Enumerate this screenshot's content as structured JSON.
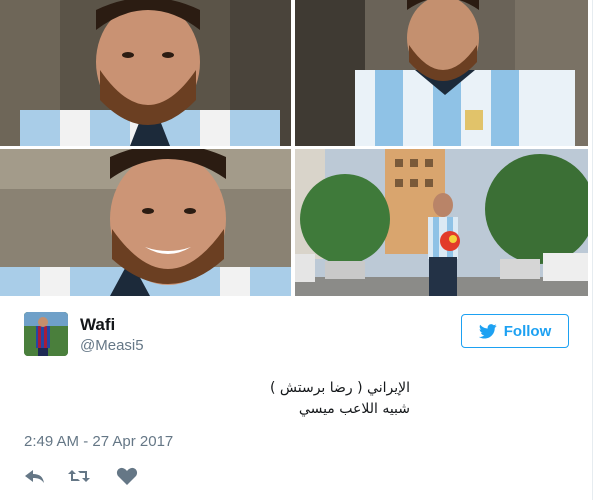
{
  "media": [
    {
      "name": "photo-closeup-smile-top-left"
    },
    {
      "name": "photo-seated-jersey"
    },
    {
      "name": "photo-closeup-laughing"
    },
    {
      "name": "photo-street-with-ball"
    }
  ],
  "author": {
    "display_name": "Wafi",
    "handle": "@Measi5"
  },
  "follow_button": {
    "label": "Follow",
    "icon": "twitter-bird-icon",
    "color": "#1da1f2"
  },
  "tweet": {
    "lines": [
      "الإيراني ( رضا برستش )",
      "شبيه اللاعب ميسي"
    ],
    "timestamp": "2:49 AM - 27 Apr 2017"
  },
  "actions": [
    {
      "name": "reply",
      "icon": "reply-icon"
    },
    {
      "name": "retweet",
      "icon": "retweet-icon"
    },
    {
      "name": "like",
      "icon": "heart-icon"
    }
  ],
  "colors": {
    "text_primary": "#14171a",
    "text_secondary": "#657786",
    "icon_gray": "#657786"
  }
}
